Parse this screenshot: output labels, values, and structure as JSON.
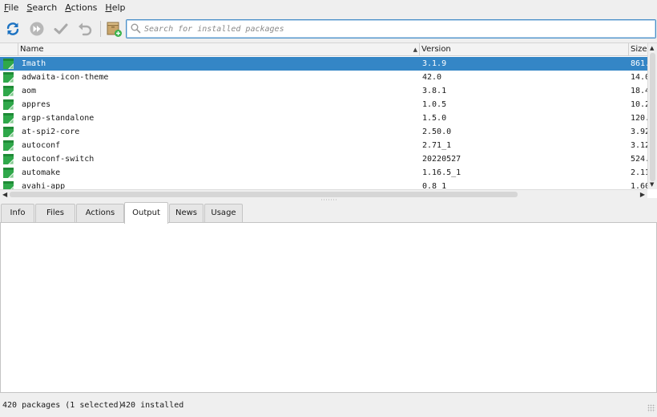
{
  "menubar": {
    "items": [
      {
        "mnemonic": "F",
        "rest": "ile"
      },
      {
        "mnemonic": "S",
        "rest": "earch"
      },
      {
        "mnemonic": "A",
        "rest": "ctions"
      },
      {
        "mnemonic": "H",
        "rest": "elp"
      }
    ]
  },
  "toolbar": {
    "icons": [
      "refresh-icon",
      "upgrade-all-icon",
      "apply-icon",
      "undo-icon",
      "install-local-package-icon"
    ],
    "search": {
      "placeholder": "Search for installed packages",
      "value": ""
    },
    "accent": "#1e73c2"
  },
  "table": {
    "columns": {
      "name": "Name",
      "version": "Version",
      "size": "Size"
    },
    "sort": {
      "column": "Name",
      "direction": "ascending"
    },
    "rows": [
      {
        "name": "Imath",
        "version": "3.1.9",
        "size": "861.",
        "selected": true
      },
      {
        "name": "adwaita-icon-theme",
        "version": "42.0",
        "size": "14.0",
        "selected": false
      },
      {
        "name": "aom",
        "version": "3.8.1",
        "size": "18.4",
        "selected": false
      },
      {
        "name": "appres",
        "version": "1.0.5",
        "size": "10.2",
        "selected": false
      },
      {
        "name": "argp-standalone",
        "version": "1.5.0",
        "size": "120.",
        "selected": false
      },
      {
        "name": "at-spi2-core",
        "version": "2.50.0",
        "size": "3.92",
        "selected": false
      },
      {
        "name": "autoconf",
        "version": "2.71_1",
        "size": "3.12",
        "selected": false
      },
      {
        "name": "autoconf-switch",
        "version": "20220527",
        "size": "524.",
        "selected": false
      },
      {
        "name": "automake",
        "version": "1.16.5_1",
        "size": "2.11",
        "selected": false
      },
      {
        "name": "avahi-app",
        "version": "0.8_1",
        "size": "1.60",
        "selected": false
      }
    ],
    "selected_color": "#3486c6",
    "icon_color": "#2fa84a"
  },
  "tabs": {
    "items": [
      "Info",
      "Files",
      "Actions",
      "Output",
      "News",
      "Usage"
    ],
    "active": "Output"
  },
  "status": {
    "count": "420 packages (1 selected)",
    "installed": "420 installed"
  }
}
